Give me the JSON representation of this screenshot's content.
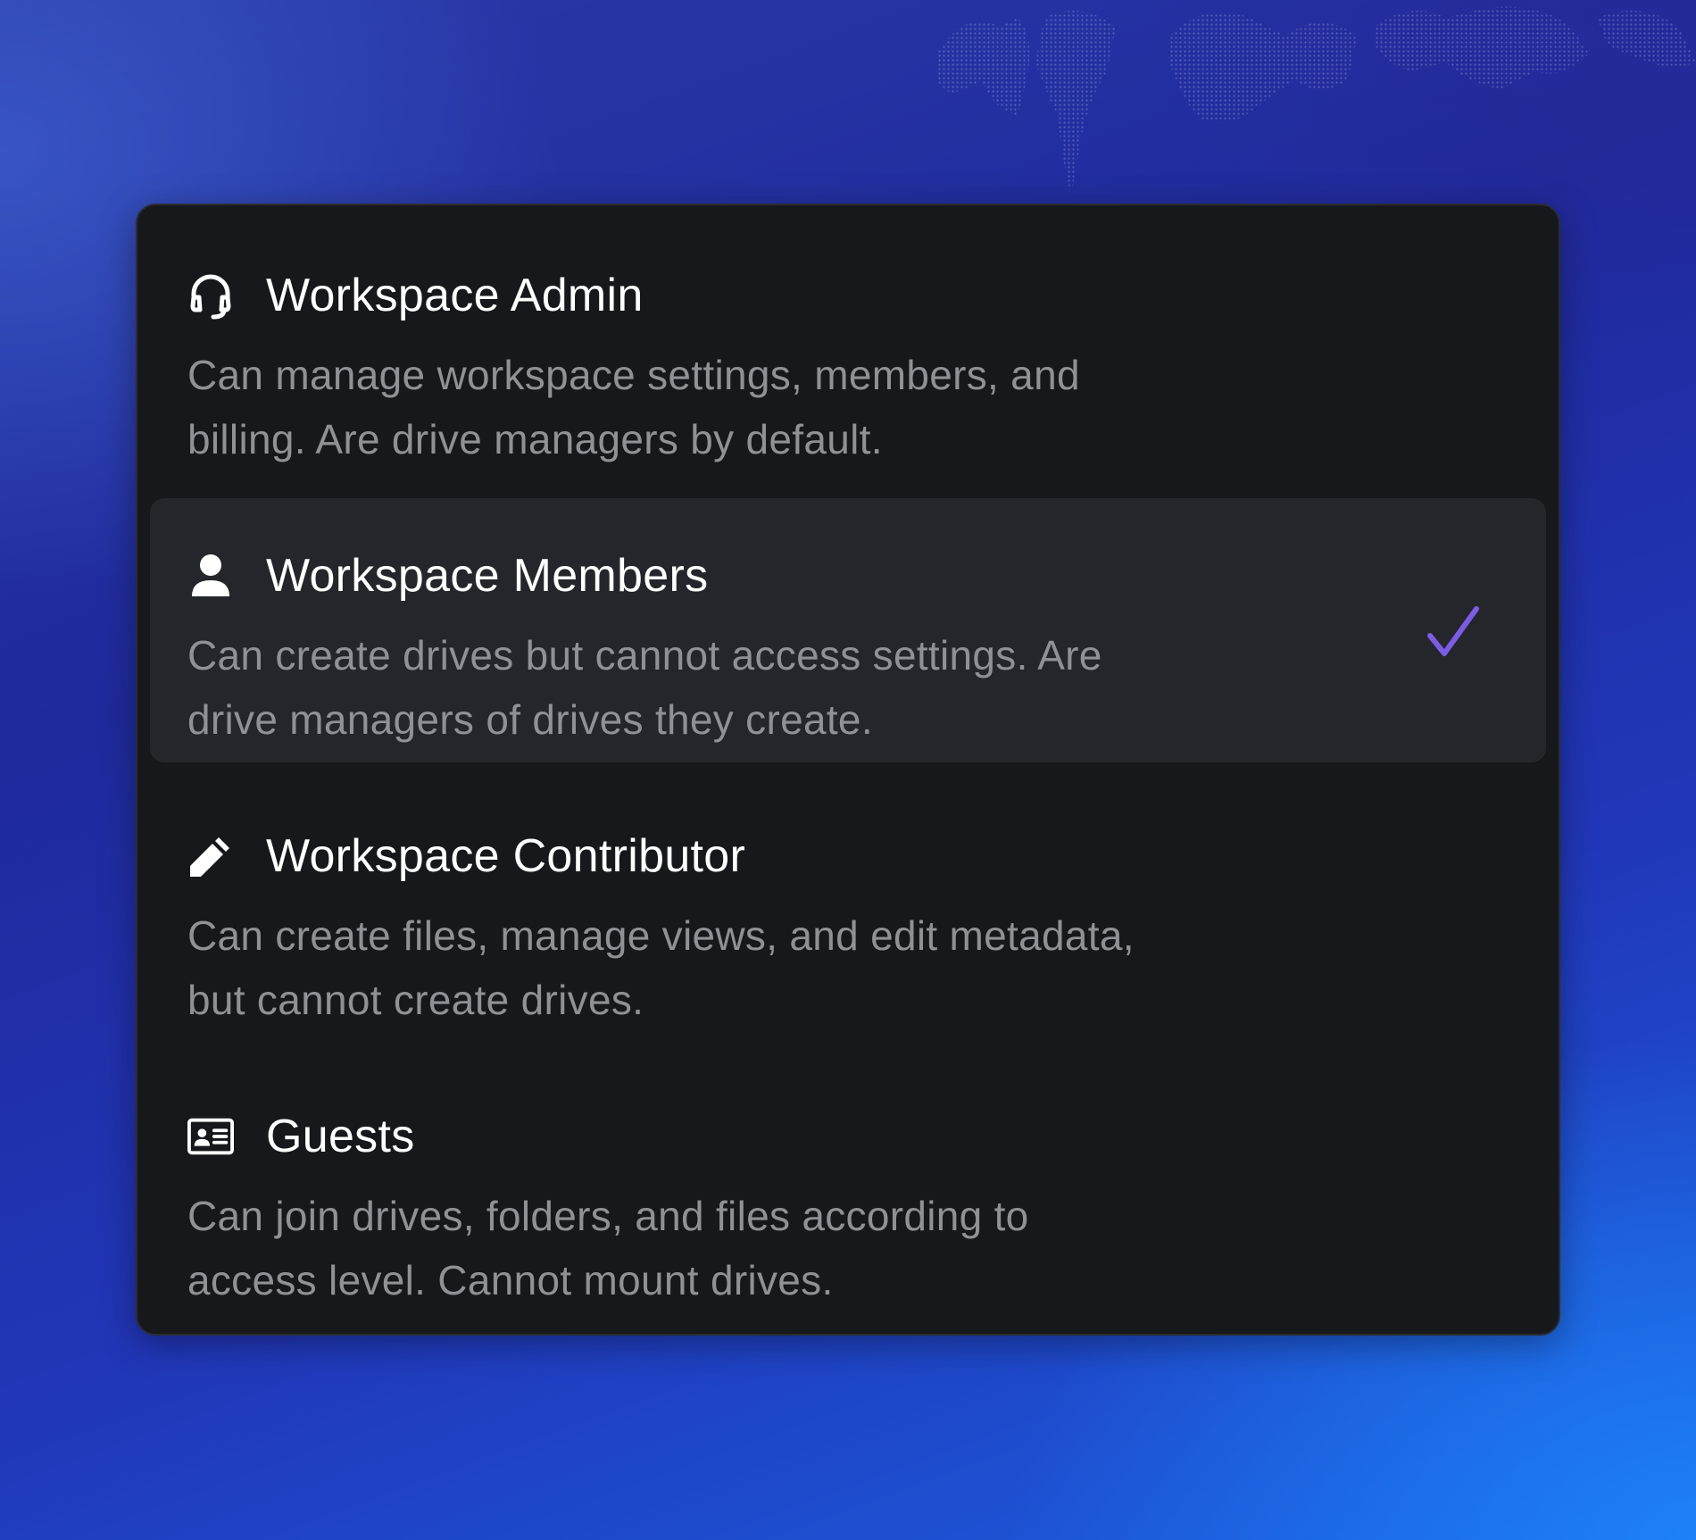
{
  "roles": [
    {
      "id": "admin",
      "icon": "headset-icon",
      "title": "Workspace Admin",
      "description": "Can manage workspace settings, members, and billing. Are drive managers by default.",
      "selected": false
    },
    {
      "id": "members",
      "icon": "person-icon",
      "title": "Workspace Members",
      "description": "Can create drives but cannot access settings. Are drive managers of drives they create.",
      "selected": true
    },
    {
      "id": "contributor",
      "icon": "pencil-icon",
      "title": "Workspace Contributor",
      "description": "Can create files, manage views, and edit metadata, but cannot create drives.",
      "selected": false
    },
    {
      "id": "guests",
      "icon": "id-card-icon",
      "title": "Guests",
      "description": "Can join drives, folders, and files according to access level. Cannot mount drives.",
      "selected": false
    }
  ],
  "colors": {
    "panel_bg": "#17181c",
    "selected_bg": "#25262b",
    "title_text": "#ffffff",
    "description_text": "#8f9197",
    "check_accent": "#7b5ce6"
  }
}
